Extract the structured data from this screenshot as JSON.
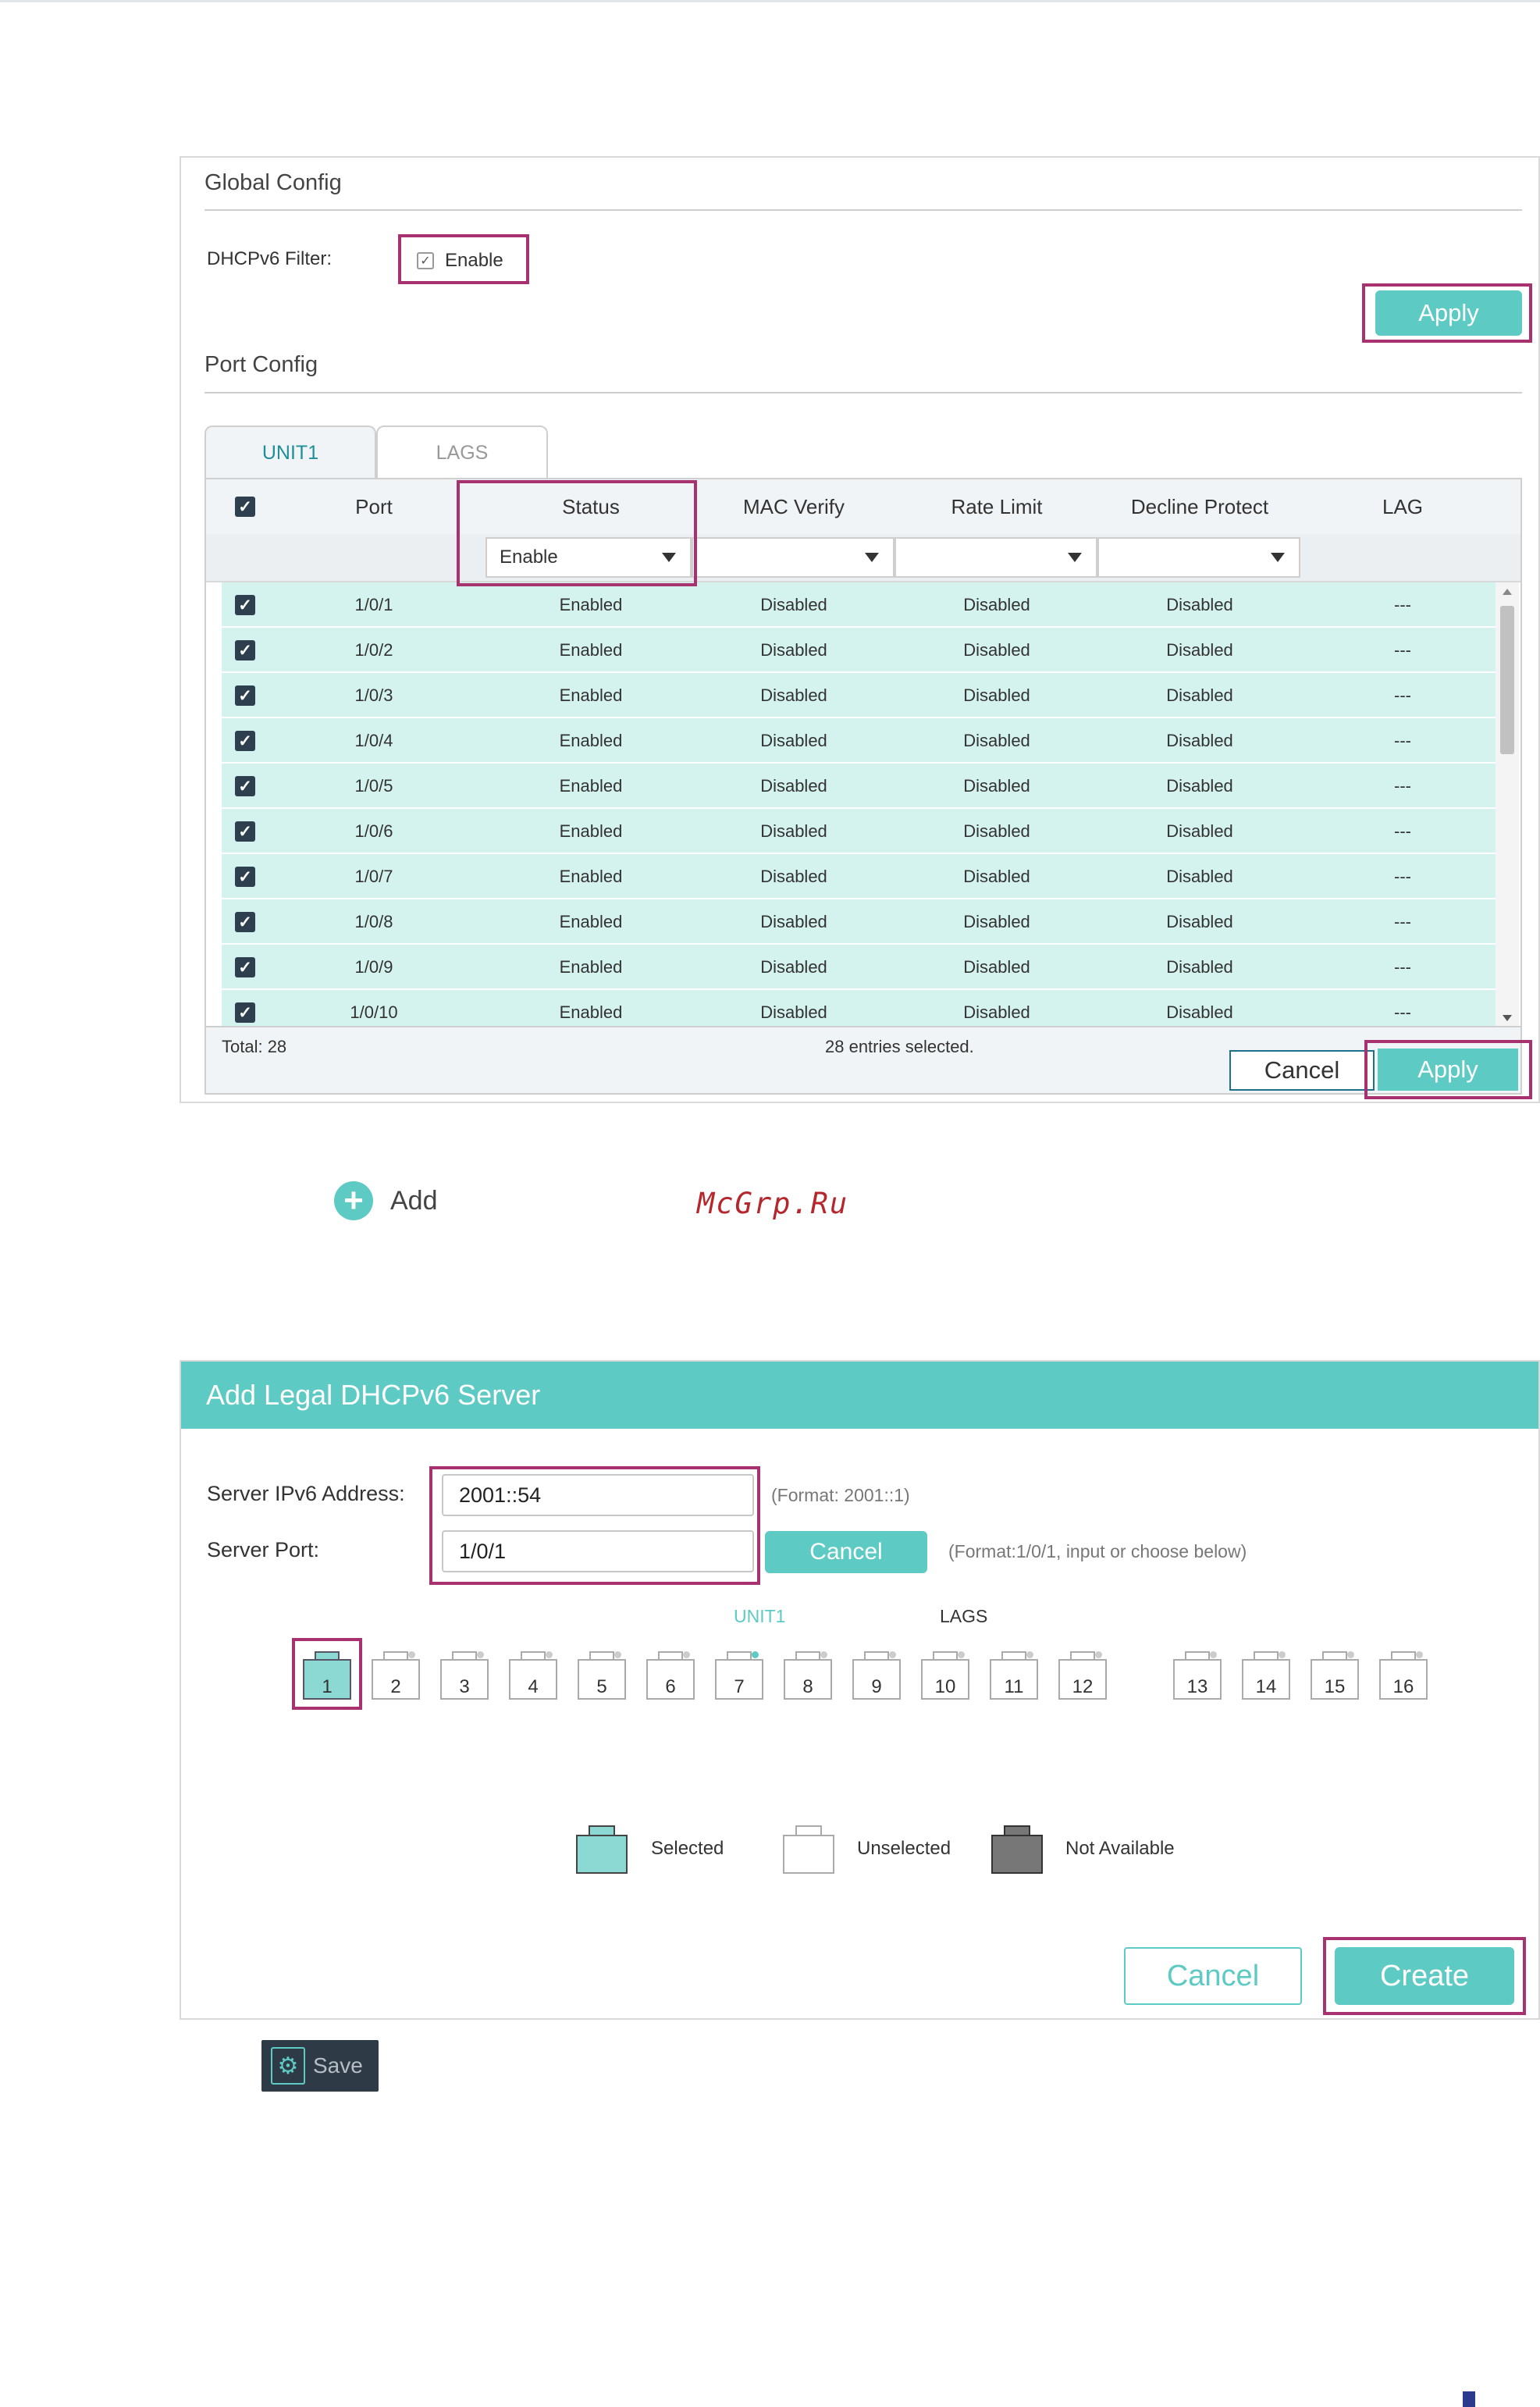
{
  "global_config": {
    "title": "Global Config",
    "dhcpv6_filter_label": "DHCPv6 Filter:",
    "enable_label": "Enable",
    "enable_checked": true,
    "apply_label": "Apply"
  },
  "port_config": {
    "title": "Port Config",
    "tabs": [
      {
        "label": "UNIT1",
        "active": true
      },
      {
        "label": "LAGS",
        "active": false
      }
    ],
    "columns": [
      "Port",
      "Status",
      "MAC Verify",
      "Rate Limit",
      "Decline Protect",
      "LAG"
    ],
    "filter_status_value": "Enable",
    "rows": [
      {
        "port": "1/0/1",
        "status": "Enabled",
        "mac_verify": "Disabled",
        "rate_limit": "Disabled",
        "decline_protect": "Disabled",
        "lag": "---"
      },
      {
        "port": "1/0/2",
        "status": "Enabled",
        "mac_verify": "Disabled",
        "rate_limit": "Disabled",
        "decline_protect": "Disabled",
        "lag": "---"
      },
      {
        "port": "1/0/3",
        "status": "Enabled",
        "mac_verify": "Disabled",
        "rate_limit": "Disabled",
        "decline_protect": "Disabled",
        "lag": "---"
      },
      {
        "port": "1/0/4",
        "status": "Enabled",
        "mac_verify": "Disabled",
        "rate_limit": "Disabled",
        "decline_protect": "Disabled",
        "lag": "---"
      },
      {
        "port": "1/0/5",
        "status": "Enabled",
        "mac_verify": "Disabled",
        "rate_limit": "Disabled",
        "decline_protect": "Disabled",
        "lag": "---"
      },
      {
        "port": "1/0/6",
        "status": "Enabled",
        "mac_verify": "Disabled",
        "rate_limit": "Disabled",
        "decline_protect": "Disabled",
        "lag": "---"
      },
      {
        "port": "1/0/7",
        "status": "Enabled",
        "mac_verify": "Disabled",
        "rate_limit": "Disabled",
        "decline_protect": "Disabled",
        "lag": "---"
      },
      {
        "port": "1/0/8",
        "status": "Enabled",
        "mac_verify": "Disabled",
        "rate_limit": "Disabled",
        "decline_protect": "Disabled",
        "lag": "---"
      },
      {
        "port": "1/0/9",
        "status": "Enabled",
        "mac_verify": "Disabled",
        "rate_limit": "Disabled",
        "decline_protect": "Disabled",
        "lag": "---"
      },
      {
        "port": "1/0/10",
        "status": "Enabled",
        "mac_verify": "Disabled",
        "rate_limit": "Disabled",
        "decline_protect": "Disabled",
        "lag": "---"
      }
    ],
    "total_label": "Total: 28",
    "selected_label": "28 entries selected.",
    "cancel_label": "Cancel",
    "apply_label": "Apply"
  },
  "add_link": {
    "label": "Add"
  },
  "watermark": "McGrp.Ru",
  "add_server": {
    "title": "Add Legal DHCPv6 Server",
    "ipv6_label": "Server IPv6 Address:",
    "ipv6_value": "2001::54",
    "ipv6_hint": "(Format: 2001::1)",
    "port_label": "Server Port:",
    "port_value": "1/0/1",
    "port_cancel_label": "Cancel",
    "port_hint": "(Format:1/0/1, input or choose below)",
    "unit_tab": "UNIT1",
    "lags_tab": "LAGS",
    "ports_group1": [
      "1",
      "2",
      "3",
      "4",
      "5",
      "6",
      "7",
      "8",
      "9",
      "10",
      "11",
      "12"
    ],
    "ports_group2": [
      "13",
      "14",
      "15",
      "16"
    ],
    "selected_port": "1",
    "legend": {
      "selected": "Selected",
      "unselected": "Unselected",
      "not_available": "Not Available"
    },
    "cancel_label": "Cancel",
    "create_label": "Create"
  },
  "save_button": {
    "label": "Save",
    "icon": "save-settings-icon"
  },
  "colors": {
    "accent": "#5ecac4",
    "highlight": "#a8326f",
    "row_bg": "#d4f2ee",
    "dark": "#2e3a45"
  }
}
